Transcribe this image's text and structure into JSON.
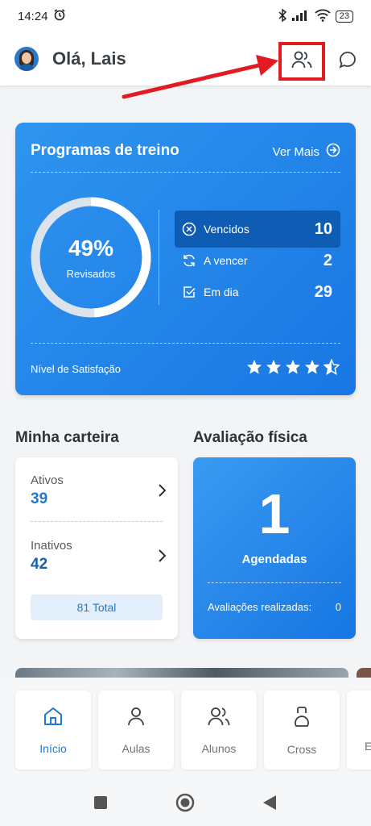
{
  "status": {
    "time": "14:24",
    "battery": "23"
  },
  "header": {
    "greeting": "Olá, Lais"
  },
  "training": {
    "title": "Programas de treino",
    "more": "Ver Mais",
    "percent": "49%",
    "percent_value": 0.49,
    "percent_label": "Revisados",
    "stats": [
      {
        "label": "Vencidos",
        "value": "10",
        "icon": "x-circle-icon"
      },
      {
        "label": "A vencer",
        "value": "2",
        "icon": "refresh-icon"
      },
      {
        "label": "Em dia",
        "value": "29",
        "icon": "check-square-icon"
      }
    ],
    "satisfaction_label": "Nível de Satisfação",
    "satisfaction_stars": 4.5
  },
  "wallet": {
    "title": "Minha carteira",
    "active_label": "Ativos",
    "active_value": "39",
    "inactive_label": "Inativos",
    "inactive_value": "42",
    "total": "81 Total"
  },
  "evaluation": {
    "title": "Avaliação física",
    "scheduled_value": "1",
    "scheduled_label": "Agendadas",
    "done_label": "Avaliações realizadas:",
    "done_value": "0"
  },
  "nav": [
    {
      "label": "Início",
      "icon": "home-icon",
      "active": true
    },
    {
      "label": "Aulas",
      "icon": "user-icon",
      "active": false
    },
    {
      "label": "Alunos",
      "icon": "users-icon",
      "active": false
    },
    {
      "label": "Cross",
      "icon": "kettlebell-icon",
      "active": false
    },
    {
      "label": "E",
      "icon": "more-icon",
      "active": false
    }
  ],
  "colors": {
    "primary": "#1f78d1",
    "card_blue": "#2f95ef",
    "highlight": "#e21b22"
  }
}
